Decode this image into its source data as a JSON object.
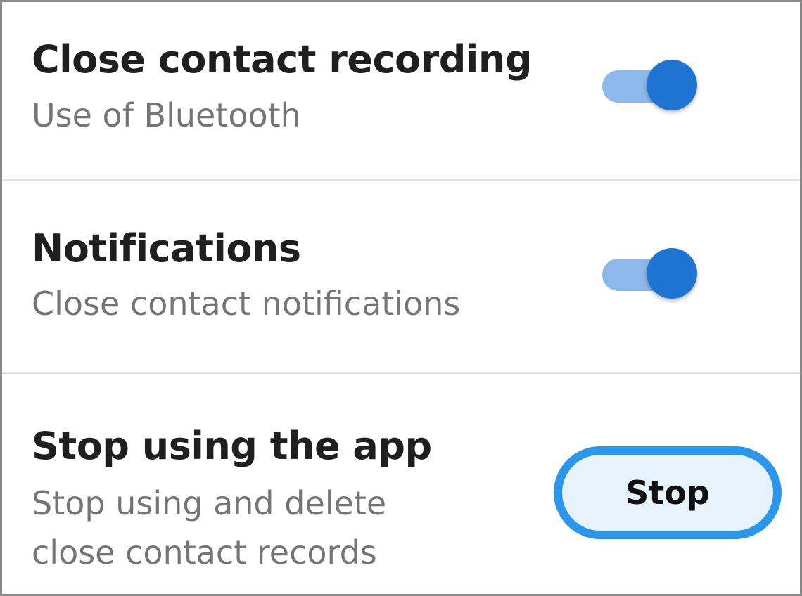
{
  "colors": {
    "toggle_track": "#8db9ea",
    "toggle_knob": "#1d74d3",
    "button_border": "#2a96ec",
    "button_fill": "#e6f3fd",
    "title_text": "#1f1f1f",
    "subtitle_text": "#757575",
    "divider": "#e2e2e2"
  },
  "settings": {
    "close_contact_recording": {
      "title": "Close contact recording",
      "subtitle": "Use of Bluetooth",
      "enabled": true
    },
    "notifications": {
      "title": "Notifications",
      "subtitle": "Close contact notifications",
      "enabled": true
    },
    "stop_app": {
      "title": "Stop using the app",
      "subtitle_line1": "Stop using and delete",
      "subtitle_line2": "close contact records",
      "button_label": "Stop"
    }
  }
}
